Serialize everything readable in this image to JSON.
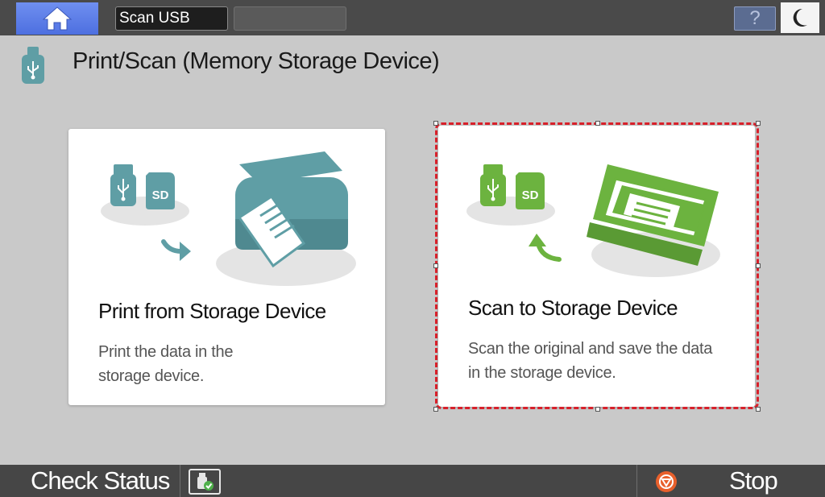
{
  "topbar": {
    "home_icon": "home-icon",
    "active_tab": "Scan USB",
    "help_label": "?",
    "sleep_icon": "moon-icon"
  },
  "header": {
    "icon": "usb-icon",
    "title": "Print/Scan (Memory Storage Device)"
  },
  "cards": [
    {
      "title": "Print from Storage Device",
      "desc_lines": [
        "Print the data in the",
        "storage device."
      ],
      "accent": "#5f9ea5",
      "badge": "SD"
    },
    {
      "title": "Scan to Storage Device",
      "desc_lines": [
        "Scan the original and save the data",
        "in the storage device."
      ],
      "accent": "#6cb33f",
      "badge": "SD",
      "selected": true
    }
  ],
  "bottombar": {
    "check_status": "Check Status",
    "stop": "Stop",
    "stop_color": "#e8602c"
  },
  "colors": {
    "background": "#c9c9c9",
    "topbar": "#4a4a4a",
    "home": "#5a7be8",
    "selection": "#d8202a"
  }
}
